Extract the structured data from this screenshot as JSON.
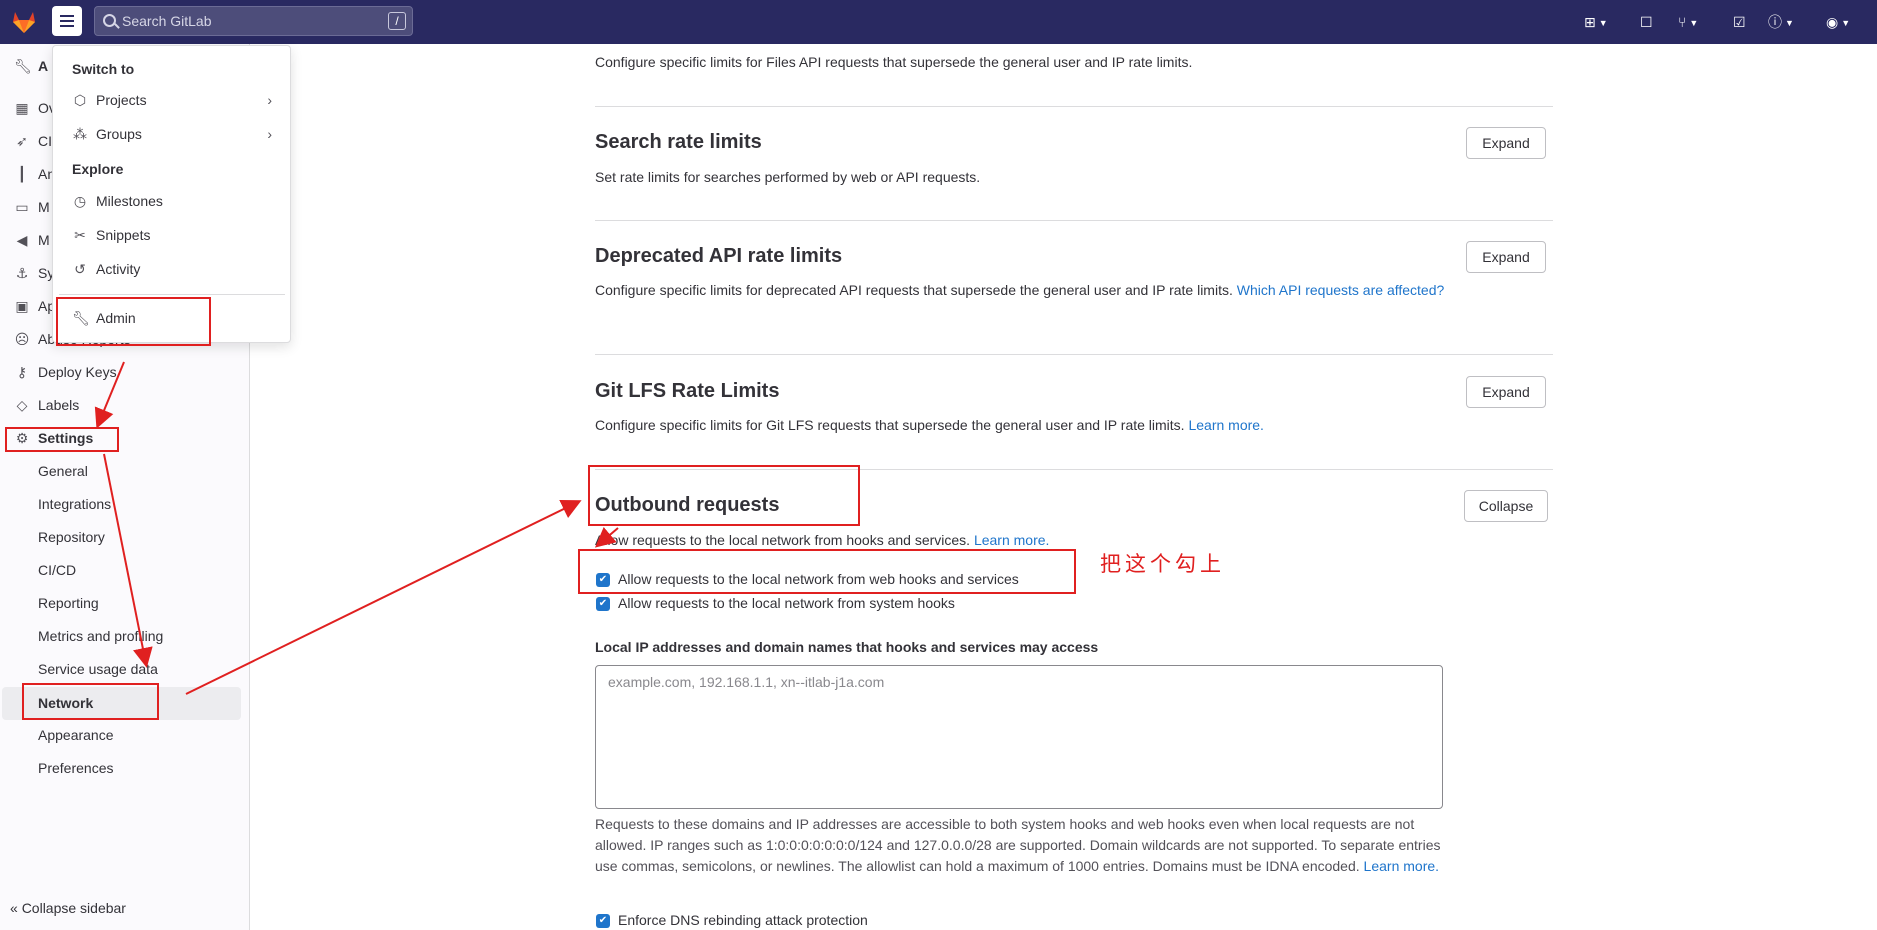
{
  "topbar": {
    "search_placeholder": "Search GitLab",
    "search_shortcut": "/",
    "icons": [
      "plus-square-icon",
      "issues-icon",
      "merge-request-icon",
      "todo-icon",
      "help-icon",
      "avatar"
    ]
  },
  "dropdown": {
    "switch_to": "Switch to",
    "projects": "Projects",
    "groups": "Groups",
    "explore": "Explore",
    "milestones": "Milestones",
    "snippets": "Snippets",
    "activity": "Activity",
    "admin": "Admin"
  },
  "sidebar": {
    "items": [
      {
        "label": "A",
        "icon": "wrench-icon"
      },
      {
        "label": "Ov",
        "icon": "overview-icon"
      },
      {
        "label": "CI",
        "icon": "rocket-icon"
      },
      {
        "label": "An",
        "icon": "chart-icon"
      },
      {
        "label": "M",
        "icon": "monitor-icon"
      },
      {
        "label": "M",
        "icon": "messages-icon"
      },
      {
        "label": "Sy",
        "icon": "anchor-icon"
      },
      {
        "label": "Ap",
        "icon": "applications-icon"
      },
      {
        "label": "Abuse Reports",
        "icon": "abuse-icon"
      }
    ],
    "deploy_keys": "Deploy Keys",
    "labels": "Labels",
    "settings": "Settings",
    "settings_children": [
      "General",
      "Integrations",
      "Repository",
      "CI/CD",
      "Reporting",
      "Metrics and profiling",
      "Service usage data"
    ],
    "network": "Network",
    "after_network": [
      "Appearance",
      "Preferences"
    ],
    "collapse": "Collapse sidebar"
  },
  "main": {
    "files_api_desc": "Configure specific limits for Files API requests that supersede the general user and IP rate limits.",
    "search": {
      "title": "Search rate limits",
      "desc": "Set rate limits for searches performed by web or API requests.",
      "button": "Expand"
    },
    "deprecated": {
      "title": "Deprecated API rate limits",
      "desc": "Configure specific limits for deprecated API requests that supersede the general user and IP rate limits.",
      "link1": "Which API requests are",
      "link2": "affected?",
      "button": "Expand"
    },
    "lfs": {
      "title": "Git LFS Rate Limits",
      "desc": "Configure specific limits for Git LFS requests that supersede the general user and IP rate limits.",
      "link": "Learn more.",
      "button": "Expand"
    },
    "outbound": {
      "title": "Outbound requests",
      "desc": "Allow requests to the local network from hooks and services.",
      "link": "Learn more.",
      "button": "Collapse",
      "check_web": "Allow requests to the local network from web hooks and services",
      "check_system": "Allow requests to the local network from system hooks",
      "field_label": "Local IP addresses and domain names that hooks and services may access",
      "placeholder": "example.com, 192.168.1.1, xn--itlab-j1a.com",
      "help": "Requests to these domains and IP addresses are accessible to both system hooks and web hooks even when local requests are not allowed. IP ranges such as 1:0:0:0:0:0:0:0/124 and 127.0.0.0/28 are supported. Domain wildcards are not supported. To separate entries use commas, semicolons, or newlines. The allowlist can hold a maximum of 1000 entries. Domains must be IDNA encoded.",
      "help_link": "Learn more.",
      "check_dns": "Enforce DNS rebinding attack protection"
    }
  },
  "annotation": {
    "note": "把这个勾上",
    "color": "#e02020"
  }
}
